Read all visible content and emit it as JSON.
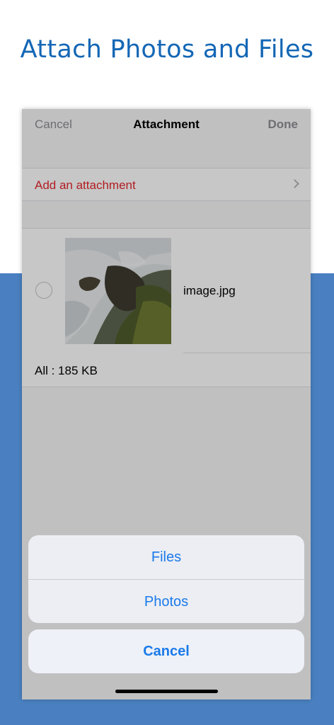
{
  "headline": "Attach Photos and Files",
  "nav": {
    "cancel_label": "Cancel",
    "title": "Attachment",
    "done_label": "Done"
  },
  "add_attachment_label": "Add an attachment",
  "attachments": [
    {
      "name": "image.jpg",
      "thumbnail_icon": "waterfall-photo"
    }
  ],
  "total_size_label": "All : 185 KB",
  "action_sheet": {
    "options": [
      "Files",
      "Photos"
    ],
    "cancel_label": "Cancel"
  },
  "colors": {
    "headline": "#1467b5",
    "band": "#4a80c1",
    "destructive_red": "#e3262d",
    "action_blue": "#1a7aea"
  }
}
